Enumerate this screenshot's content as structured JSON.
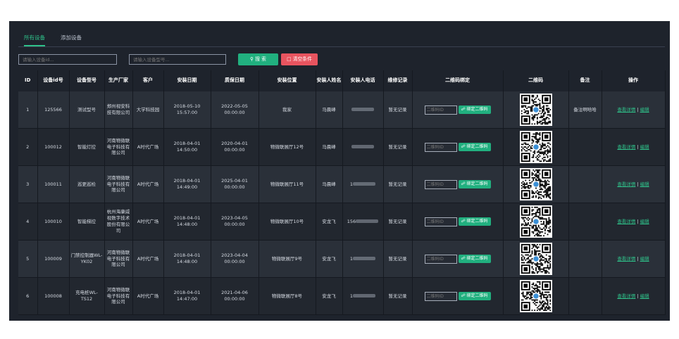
{
  "tabs": [
    {
      "label": "所有设备",
      "active": true
    },
    {
      "label": "添加设备",
      "active": false
    }
  ],
  "search": {
    "id_placeholder": "请输入设备id...",
    "model_placeholder": "请输入设备型号...",
    "search_label": "搜 索",
    "clear_label": "清空条件"
  },
  "table": {
    "headers": [
      "ID",
      "设备id号",
      "设备型号",
      "生产厂家",
      "客户",
      "安装日期",
      "质保日期",
      "安装位置",
      "安装人姓名",
      "安装人电话",
      "维修记录",
      "二维码绑定",
      "二维码",
      "备注",
      "操作"
    ],
    "qr_placeholder": "二维码ID",
    "bind_label": "绑定二维码",
    "detail_label": "查看详情",
    "edit_label": "编辑",
    "rows": [
      {
        "id": "1",
        "device_id": "125566",
        "model": "测试型号",
        "maker": "郑州视安科技有限公司",
        "customer": "大学科技园",
        "install_date": "2018-05-10 15:57:00",
        "warranty_date": "2022-05-05 00:00:00",
        "location": "我家",
        "installer": "马晨峰",
        "phone_prefix": "",
        "repair": "暂无记录",
        "note": "备注啊哈哈"
      },
      {
        "id": "2",
        "device_id": "100012",
        "model": "智能灯控",
        "maker": "河南物微联电子科技有限公司",
        "customer": "A时代广场",
        "install_date": "2018-04-01 14:50:00",
        "warranty_date": "2020-04-01 00:00:00",
        "location": "物微联展厅12号",
        "installer": "马晨峰",
        "phone_prefix": "",
        "repair": "暂无记录",
        "note": ""
      },
      {
        "id": "3",
        "device_id": "100011",
        "model": "巡更巡检",
        "maker": "河南物微联电子科技有限公司",
        "customer": "A时代广场",
        "install_date": "2018-04-01 14:49:00",
        "warranty_date": "2025-04-01 00:00:00",
        "location": "物微联展厅11号",
        "installer": "马晨峰",
        "phone_prefix": "1",
        "repair": "暂无记录",
        "note": ""
      },
      {
        "id": "4",
        "device_id": "100010",
        "model": "智能梯控",
        "maker": "杭州海康威视数字技术股份有限公司",
        "customer": "A时代广场",
        "install_date": "2018-04-01 14:48:00",
        "warranty_date": "2023-04-05 00:00:00",
        "location": "物微联展厅10号",
        "installer": "安龙飞",
        "phone_prefix": "156",
        "repair": "暂无记录",
        "note": ""
      },
      {
        "id": "5",
        "device_id": "100009",
        "model": "门禁控制器WL-YK02",
        "maker": "河南物微联电子科技有限公司",
        "customer": "A时代广场",
        "install_date": "2018-04-01 14:48:00",
        "warranty_date": "2023-04-04 00:00:00",
        "location": "物微联展厅9号",
        "installer": "安龙飞",
        "phone_prefix": "1",
        "repair": "暂无记录",
        "note": ""
      },
      {
        "id": "6",
        "device_id": "100008",
        "model": "充电桩WL-TS12",
        "maker": "河南物微联电子科技有限公司",
        "customer": "A时代广场",
        "install_date": "2018-04-01 14:47:00",
        "warranty_date": "2021-04-06 00:00:00",
        "location": "物微联展厅8号",
        "installer": "安龙飞",
        "phone_prefix": "1",
        "repair": "暂无记录",
        "note": ""
      }
    ]
  },
  "colors": {
    "accent": "#21b07f",
    "danger": "#e8545f",
    "panel": "#1e232c"
  }
}
